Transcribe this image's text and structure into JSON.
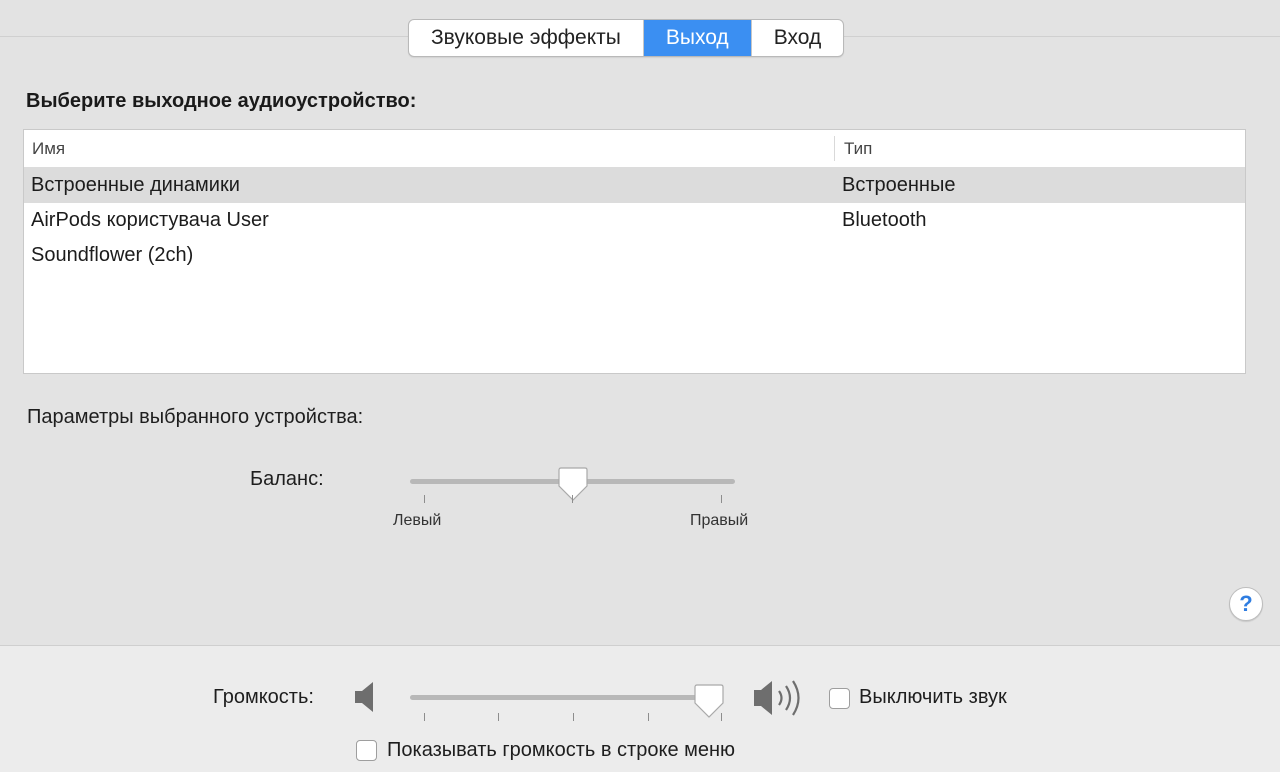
{
  "tabs": [
    {
      "label": "Звуковые эффекты",
      "active": false
    },
    {
      "label": "Выход",
      "active": true
    },
    {
      "label": "Вход",
      "active": false
    }
  ],
  "output": {
    "section_title": "Выберите выходное аудиоустройство:",
    "columns": {
      "name": "Имя",
      "type": "Тип"
    },
    "devices": [
      {
        "name": "Встроенные динамики",
        "type": "Встроенные",
        "selected": true
      },
      {
        "name": "AirPods користувача User",
        "type": "Bluetooth",
        "selected": false
      },
      {
        "name": "Soundflower (2ch)",
        "type": "",
        "selected": false
      }
    ]
  },
  "device_settings": {
    "label": "Параметры выбранного устройства:",
    "balance_label": "Баланс:",
    "balance_left_label": "Левый",
    "balance_right_label": "Правый",
    "balance_value": 0.5
  },
  "help": {
    "label": "?"
  },
  "volume": {
    "label": "Громкость:",
    "value": 0.96,
    "mute_label": "Выключить звук",
    "mute_checked": false,
    "show_in_menu_label": "Показывать громкость в строке меню",
    "show_in_menu_checked": false
  },
  "colors": {
    "accent": "#3b8ff2",
    "selected_row": "#dcdcdc",
    "help_icon": "#2f7de1"
  },
  "icons": {
    "volume_low": "speaker-low-icon",
    "volume_high": "speaker-high-icon",
    "help": "question-icon"
  }
}
